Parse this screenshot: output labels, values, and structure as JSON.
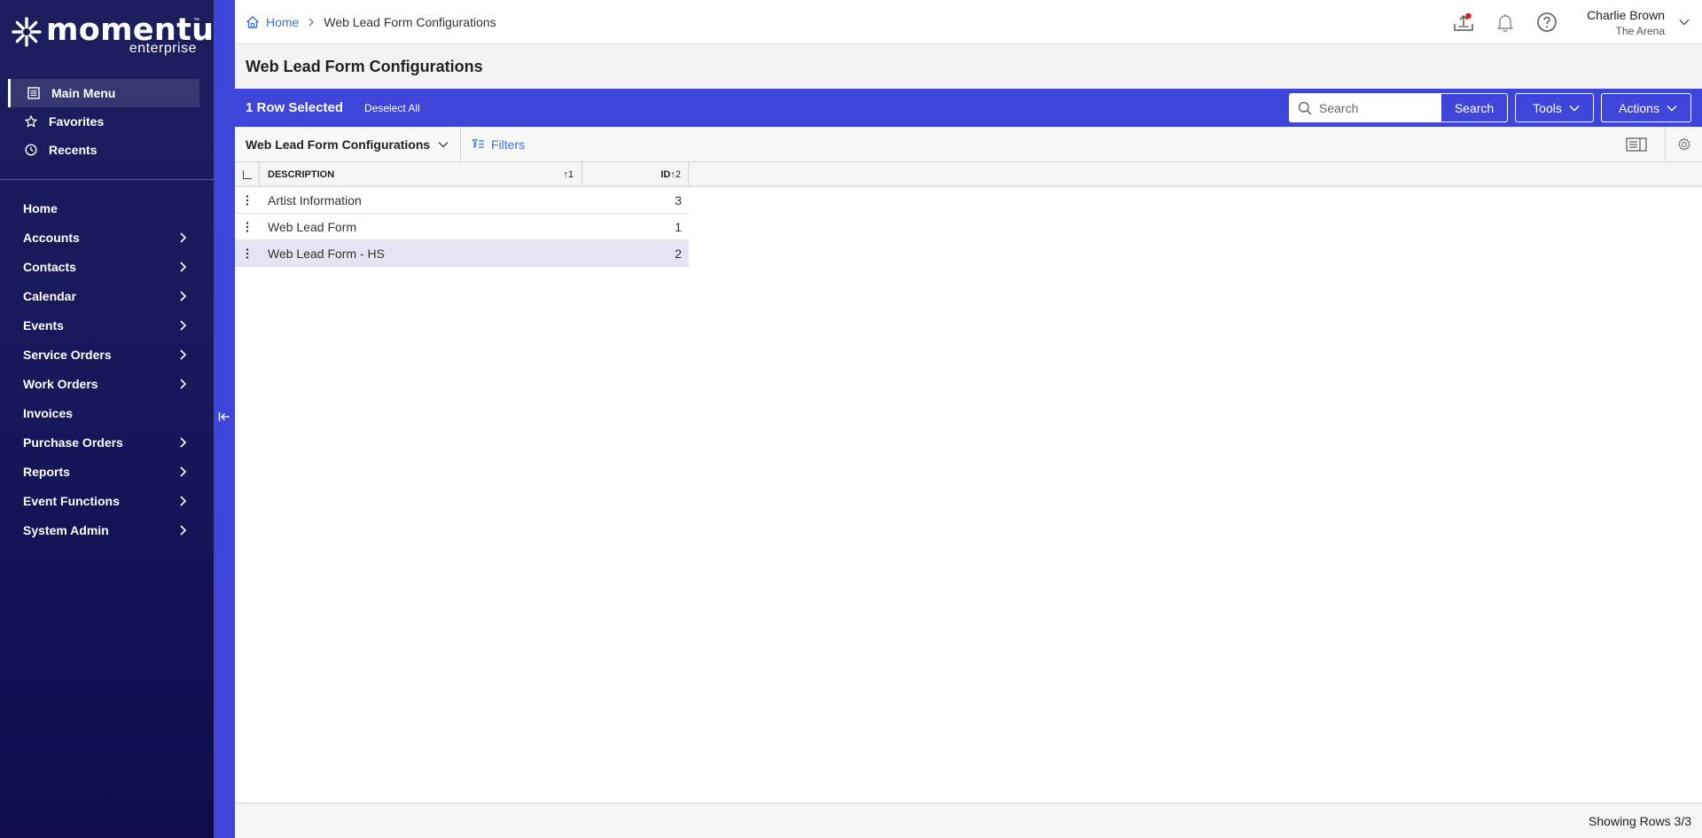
{
  "brand": {
    "name": "momentus",
    "tm": "™",
    "subtitle": "enterprise"
  },
  "sidebar": {
    "quick": [
      {
        "label": "Main Menu",
        "icon": "menu-icon",
        "active": true
      },
      {
        "label": "Favorites",
        "icon": "star-icon"
      },
      {
        "label": "Recents",
        "icon": "clock-icon"
      }
    ],
    "nav": [
      {
        "label": "Home",
        "has_children": false
      },
      {
        "label": "Accounts",
        "has_children": true
      },
      {
        "label": "Contacts",
        "has_children": true
      },
      {
        "label": "Calendar",
        "has_children": true
      },
      {
        "label": "Events",
        "has_children": true
      },
      {
        "label": "Service Orders",
        "has_children": true
      },
      {
        "label": "Work Orders",
        "has_children": true
      },
      {
        "label": "Invoices",
        "has_children": false
      },
      {
        "label": "Purchase Orders",
        "has_children": true
      },
      {
        "label": "Reports",
        "has_children": true
      },
      {
        "label": "Event Functions",
        "has_children": true
      },
      {
        "label": "System Admin",
        "has_children": true
      }
    ]
  },
  "breadcrumb": {
    "home": "Home",
    "current": "Web Lead Form Configurations"
  },
  "user": {
    "name": "Charlie Brown",
    "venue": "The Arena"
  },
  "page": {
    "title": "Web Lead Form Configurations"
  },
  "selection": {
    "count_label": "1 Row Selected",
    "deselect_label": "Deselect All"
  },
  "search": {
    "placeholder": "Search",
    "value": "",
    "button_label": "Search"
  },
  "toolbar": {
    "tools_label": "Tools",
    "actions_label": "Actions"
  },
  "view": {
    "selected": "Web Lead Form Configurations",
    "filters_label": "Filters"
  },
  "table": {
    "columns": [
      {
        "label": "DESCRIPTION",
        "sort": "↑1"
      },
      {
        "label": "ID",
        "sort": "↑2"
      }
    ],
    "rows": [
      {
        "description": "Artist Information",
        "id": "3",
        "selected": false
      },
      {
        "description": "Web Lead Form",
        "id": "1",
        "selected": false
      },
      {
        "description": "Web Lead Form - HS",
        "id": "2",
        "selected": true
      }
    ]
  },
  "footer": {
    "status": "Showing Rows 3/3"
  },
  "colors": {
    "accent": "#3e45d8",
    "sidebar": "#15175a",
    "link": "#3a6fd8",
    "selected_row": "#e5e3f4",
    "notification_dot": "#e02020"
  }
}
